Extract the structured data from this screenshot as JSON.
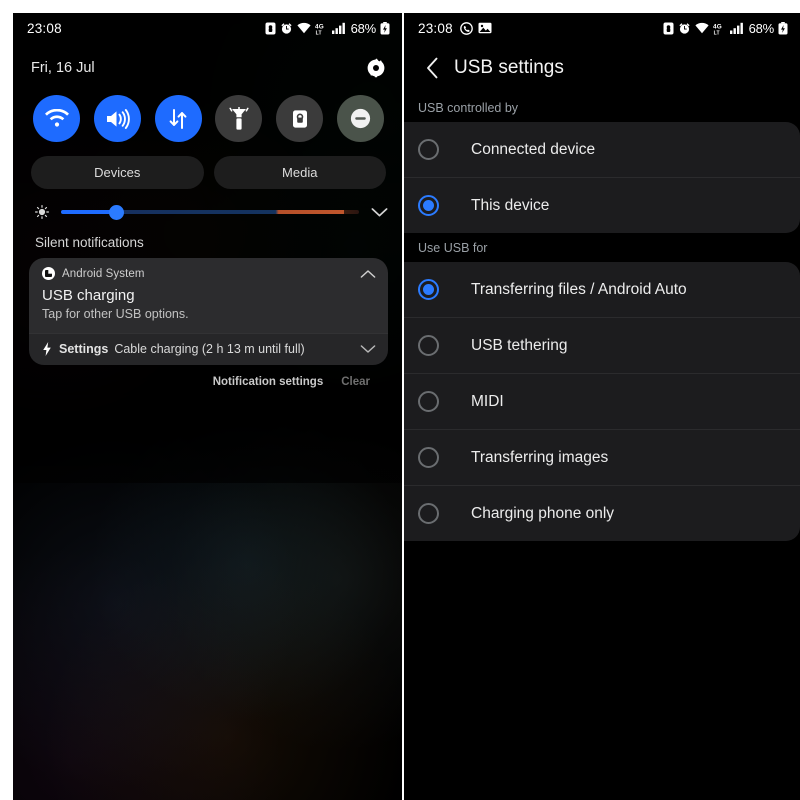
{
  "meta": {
    "accent_blue": "#1e6bff",
    "radio_blue": "#2b7bff",
    "card_bg": "#1c1c1e",
    "notification_bg": "#2c2c2e",
    "section_label_color": "#9aa0a6"
  },
  "left_panel": {
    "status_bar": {
      "clock": "23:08",
      "battery_percent": "68%",
      "icons": [
        "sim-card-lock-icon",
        "alarm-clock-icon",
        "wifi-icon",
        "4g-lte-icon",
        "signal-bars-icon",
        "battery-charging-icon"
      ]
    },
    "header": {
      "date": "Fri, 16 Jul",
      "settings_icon": "gear-icon"
    },
    "quick_toggles": [
      {
        "name": "wifi",
        "icon": "wifi-icon",
        "state": "on"
      },
      {
        "name": "sound",
        "icon": "speaker-icon",
        "state": "on"
      },
      {
        "name": "mobile-data",
        "icon": "data-arrows-icon",
        "state": "on"
      },
      {
        "name": "flashlight",
        "icon": "flashlight-icon",
        "state": "off"
      },
      {
        "name": "auto-rotate",
        "icon": "rotation-lock-icon",
        "state": "off"
      },
      {
        "name": "do-not-disturb",
        "icon": "minus-circle-icon",
        "state": "dim"
      }
    ],
    "pills": [
      {
        "label": "Devices"
      },
      {
        "label": "Media"
      }
    ],
    "brightness": {
      "icon": "brightness-sun-icon",
      "value_percent": 17,
      "expand_icon": "chevron-down-icon"
    },
    "silent_notifications_label": "Silent notifications",
    "notification": {
      "app_icon": "android-system-icon",
      "app_name": "Android System",
      "collapse_icon": "chevron-up-icon",
      "title": "USB charging",
      "subtitle": "Tap for other USB options.",
      "footer": {
        "bolt_icon": "lightning-bolt-icon",
        "app": "Settings",
        "text": "Cable charging (2 h 13 m until full)",
        "expand_icon": "chevron-down-icon"
      }
    },
    "actions": {
      "notification_settings": "Notification settings",
      "clear": "Clear"
    }
  },
  "right_panel": {
    "status_bar": {
      "clock": "23:08",
      "battery_percent": "68%",
      "left_icons": [
        "whatsapp-icon",
        "photo-icon"
      ],
      "right_icons": [
        "sim-card-lock-icon",
        "alarm-clock-icon",
        "wifi-icon",
        "4g-lte-icon",
        "signal-bars-icon",
        "battery-charging-icon"
      ]
    },
    "header": {
      "back_icon": "back-chevron-icon",
      "title": "USB settings"
    },
    "sections": [
      {
        "label": "USB controlled by",
        "options": [
          {
            "label": "Connected device",
            "selected": false
          },
          {
            "label": "This device",
            "selected": true
          }
        ]
      },
      {
        "label": "Use USB for",
        "options": [
          {
            "label": "Transferring files / Android Auto",
            "selected": true
          },
          {
            "label": "USB tethering",
            "selected": false
          },
          {
            "label": "MIDI",
            "selected": false
          },
          {
            "label": "Transferring images",
            "selected": false
          },
          {
            "label": "Charging phone only",
            "selected": false
          }
        ]
      }
    ]
  }
}
